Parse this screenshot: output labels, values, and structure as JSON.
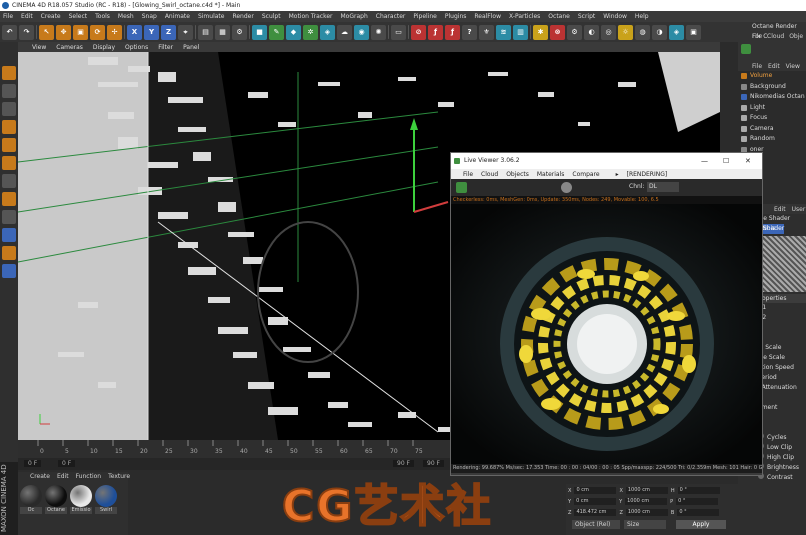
{
  "window": {
    "title": "CINEMA 4D R18.057 Studio (RC - R18) - [Glowing_Swirl_octane.c4d *] - Main"
  },
  "menubar": [
    "File",
    "Edit",
    "Create",
    "Select",
    "Tools",
    "Mesh",
    "Snap",
    "Animate",
    "Simulate",
    "Render",
    "Sculpt",
    "Motion Tracker",
    "MoGraph",
    "Character",
    "Pipeline",
    "Plugins",
    "RealFlow",
    "X-Particles",
    "Octane",
    "Script",
    "Window",
    "Help"
  ],
  "viewport_menu": [
    "View",
    "Cameras",
    "Display",
    "Options",
    "Filter",
    "Panel"
  ],
  "timeline": {
    "ticks": [
      "0",
      "5",
      "10",
      "15",
      "20",
      "25",
      "30",
      "35",
      "40",
      "45",
      "50",
      "55",
      "60",
      "65",
      "70",
      "75"
    ],
    "start": "0 F",
    "current": "0 F",
    "end": "90 F",
    "end2": "90 F"
  },
  "material_manager": {
    "menu": [
      "Create",
      "Edit",
      "Function",
      "Texture"
    ],
    "materials": [
      {
        "label": "Oc",
        "color": "#2a2a2a"
      },
      {
        "label": "Octane",
        "color": "#0d0d0d"
      },
      {
        "label": "Emissio",
        "color": "#e8e8e8"
      },
      {
        "label": "Swirl",
        "color": "#1e4f9a"
      }
    ]
  },
  "coordinates": {
    "rows": [
      {
        "axis": "X",
        "pos": "0 cm",
        "axis2": "X",
        "size": "1000 cm",
        "axis3": "H",
        "rot": "0 °"
      },
      {
        "axis": "Y",
        "pos": "0 cm",
        "axis2": "Y",
        "size": "1000 cm",
        "axis3": "P",
        "rot": "0 °"
      },
      {
        "axis": "Z",
        "pos": "418.472 cm",
        "axis2": "Z",
        "size": "1000 cm",
        "axis3": "B",
        "rot": "0 °"
      }
    ],
    "mode": "Object (Rel)",
    "size_mode": "Size",
    "apply": "Apply"
  },
  "octane_window": {
    "title": "Octane Render For C",
    "menu": [
      "File",
      "Cloud",
      "Obje"
    ]
  },
  "object_manager": {
    "menu": [
      "File",
      "Edit",
      "View"
    ],
    "items": [
      {
        "label": "Volume",
        "color": "#c77a1b",
        "active": true
      },
      {
        "label": "Background",
        "color": "#888"
      },
      {
        "label": "Nikomedias Octan",
        "color": "#3b66b8"
      },
      {
        "label": "Light",
        "color": "#aaa"
      },
      {
        "label": "Focus",
        "color": "#aaa"
      },
      {
        "label": "Camera",
        "color": "#aaa"
      },
      {
        "label": "Random",
        "color": "#aaa"
      },
      {
        "label": "oner",
        "color": "#888"
      },
      {
        "label": "ult",
        "color": "#888"
      }
    ]
  },
  "attributes": {
    "menu": [
      "Edit",
      "User"
    ],
    "title": "ce Shader [Nois",
    "tab": "Shader",
    "section": "operties",
    "items": [
      "r 1",
      "r 2",
      "",
      "",
      "al Scale",
      "ive Scale",
      "ation Speed",
      "Period",
      "l Attenuation",
      "",
      "ement",
      "",
      "d",
      "Cycles",
      "Low Clip",
      "High Clip",
      "Brightness",
      "Contrast"
    ]
  },
  "live_viewer": {
    "title": "Live Viewer 3.06.2",
    "menu": [
      "File",
      "Cloud",
      "Objects",
      "Materials",
      "Compare"
    ],
    "rendering": "[RENDERING]",
    "channel_label": "Chnl:",
    "channel_value": "DL",
    "status": "Checkerless: 0ms, MeshGen: 0ms, Update: 350ms, Nodes: 249, Movable: 100, 6.5",
    "bottom": "Rendering: 99.687%   Ms/sec: 17.353   Time: 00 : 00 : 04/00 : 00 : 05   Spp/maxspp: 224/500   Tri: 0/2.359m   Mesh: 101   Hair: 0   GPU"
  },
  "watermark": "CG艺术社",
  "side_brand": "MAXON CINEMA 4D"
}
